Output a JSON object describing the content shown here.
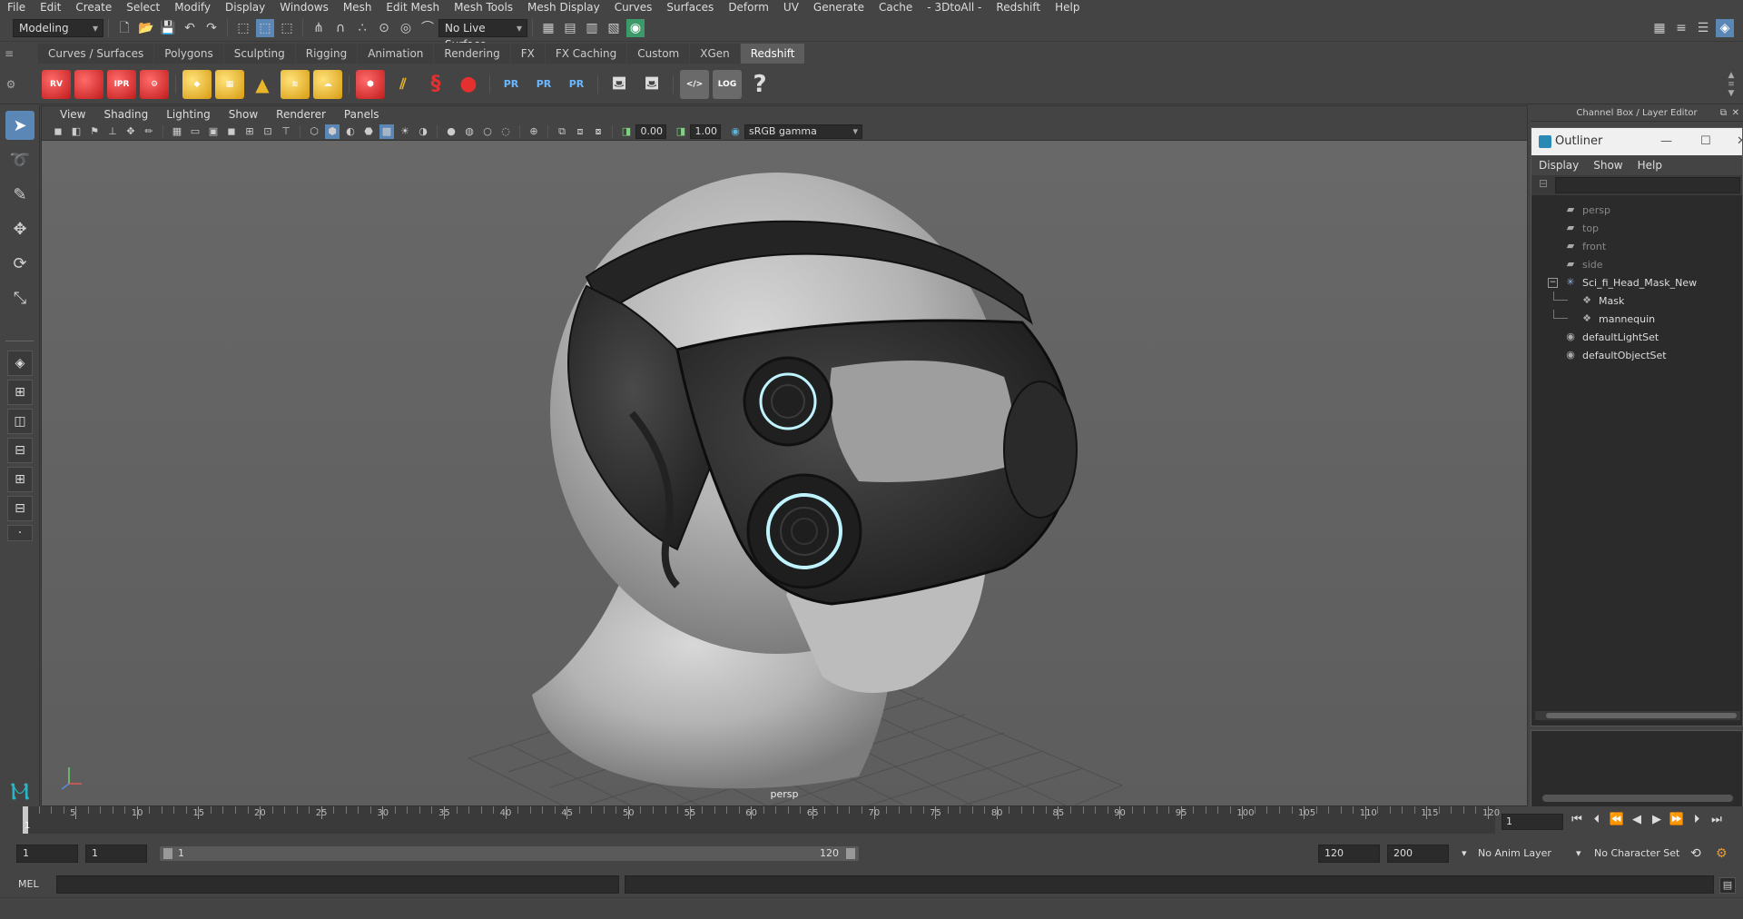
{
  "menubar": [
    "File",
    "Edit",
    "Create",
    "Select",
    "Modify",
    "Display",
    "Windows",
    "Mesh",
    "Edit Mesh",
    "Mesh Tools",
    "Mesh Display",
    "Curves",
    "Surfaces",
    "Deform",
    "UV",
    "Generate",
    "Cache",
    "- 3DtoAll -",
    "Redshift",
    "Help"
  ],
  "statusline": {
    "mode": "Modeling",
    "live_surface": "No Live Surface"
  },
  "shelf_tabs": [
    "Curves / Surfaces",
    "Polygons",
    "Sculpting",
    "Rigging",
    "Animation",
    "Rendering",
    "FX",
    "FX Caching",
    "Custom",
    "XGen",
    "Redshift"
  ],
  "shelf_active": "Redshift",
  "shelf": {
    "rv_label": "RV",
    "ipr_label": "IPR",
    "pr_label": "PR",
    "log_label": "LOG",
    "help_glyph": "?"
  },
  "viewport": {
    "menu": [
      "View",
      "Shading",
      "Lighting",
      "Show",
      "Renderer",
      "Panels"
    ],
    "exposure": "0.00",
    "gamma": "1.00",
    "color_space": "sRGB gamma",
    "camera_label": "persp"
  },
  "channel_box_title": "Channel Box / Layer Editor",
  "outliner": {
    "title": "Outliner",
    "menu": [
      "Display",
      "Show",
      "Help"
    ],
    "items": [
      {
        "label": "persp",
        "icon": "camera-icon",
        "dim": true,
        "indent": 1
      },
      {
        "label": "top",
        "icon": "camera-icon",
        "dim": true,
        "indent": 1
      },
      {
        "label": "front",
        "icon": "camera-icon",
        "dim": true,
        "indent": 1
      },
      {
        "label": "side",
        "icon": "camera-icon",
        "dim": true,
        "indent": 1
      },
      {
        "label": "Sci_fi_Head_Mask_New",
        "icon": "group-icon",
        "dim": false,
        "indent": 1,
        "expander": "−"
      },
      {
        "label": "Mask",
        "icon": "mesh-icon",
        "dim": false,
        "indent": 2
      },
      {
        "label": "mannequin",
        "icon": "mesh-icon",
        "dim": false,
        "indent": 2
      },
      {
        "label": "defaultLightSet",
        "icon": "set-icon",
        "dim": false,
        "indent": 1
      },
      {
        "label": "defaultObjectSet",
        "icon": "set-icon",
        "dim": false,
        "indent": 1
      }
    ]
  },
  "timeline": {
    "ticks": [
      1,
      5,
      10,
      15,
      20,
      25,
      30,
      35,
      40,
      45,
      50,
      55,
      60,
      65,
      70,
      75,
      80,
      85,
      90,
      95,
      100,
      105,
      110,
      115,
      120
    ],
    "current_frame": "1",
    "frame_field": "1"
  },
  "range": {
    "start_outer": "1",
    "start_inner": "1",
    "bar_start": "1",
    "bar_end": "120",
    "end_inner": "120",
    "end_outer": "200",
    "anim_layer": "No Anim Layer",
    "character_set": "No Character Set"
  },
  "cmdline": {
    "lang": "MEL"
  }
}
